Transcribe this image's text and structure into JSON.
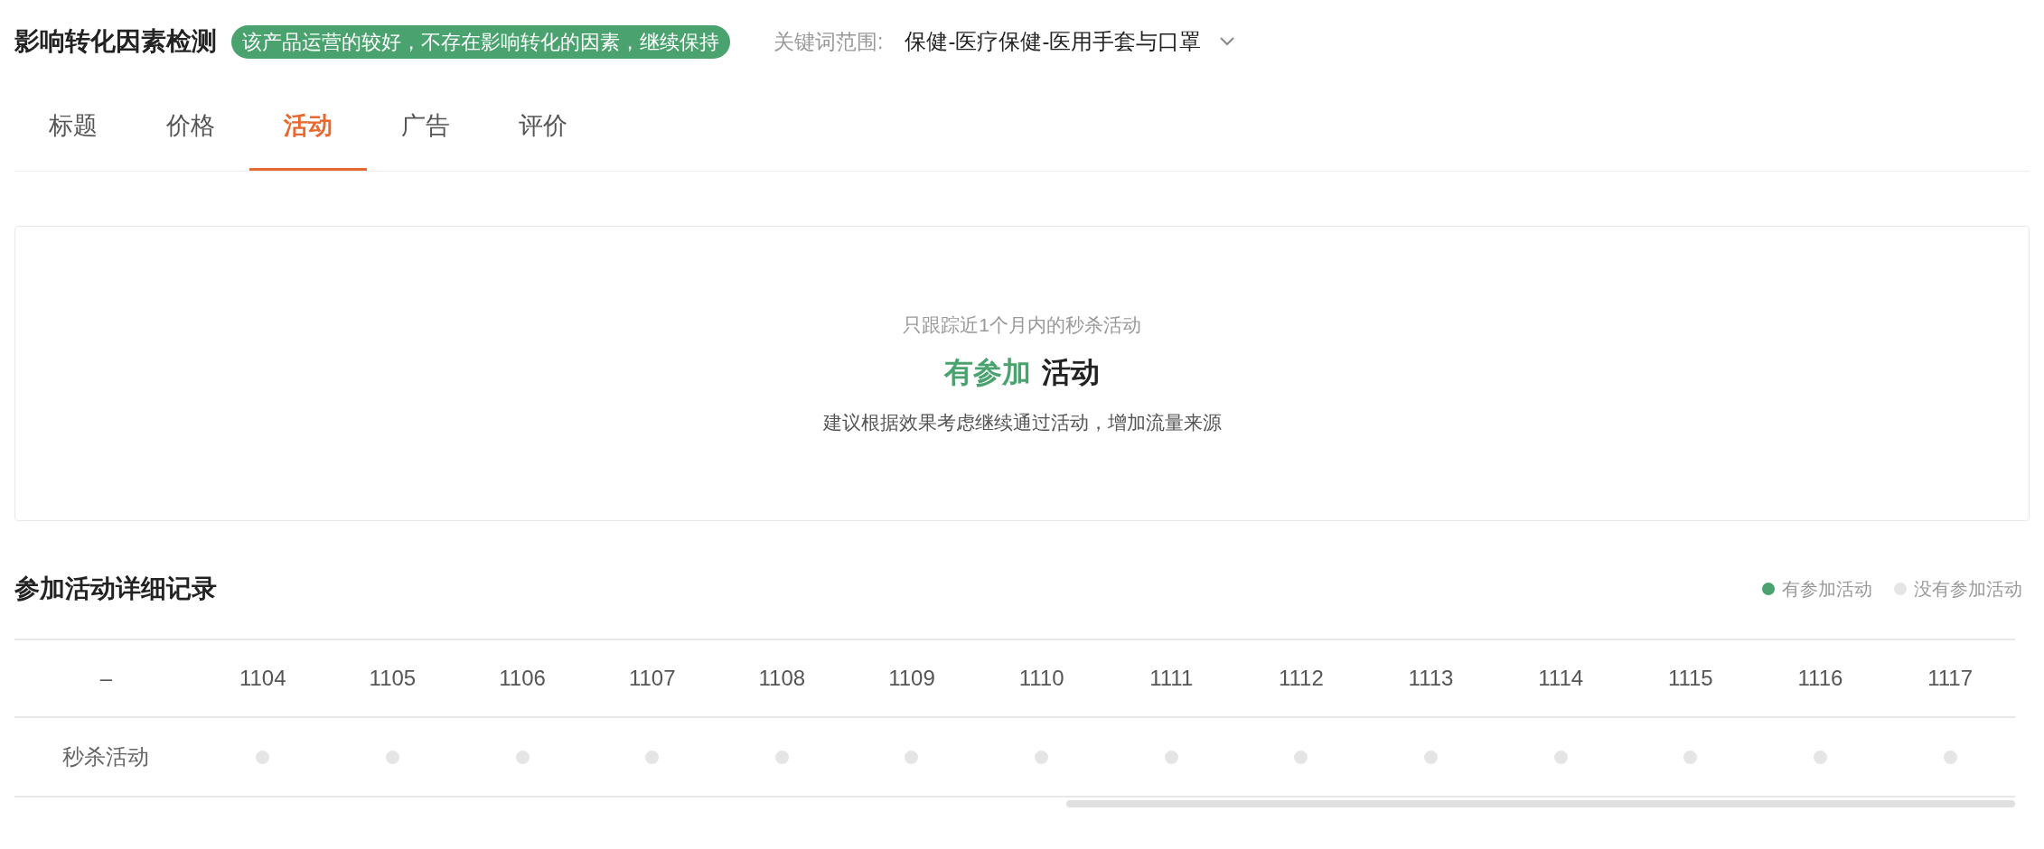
{
  "header": {
    "title": "影响转化因素检测",
    "badge": "该产品运营的较好，不存在影响转化的因素，继续保持",
    "keyword_label": "关键词范围:",
    "keyword_value": "保健-医疗保健-医用手套与口罩"
  },
  "tabs": [
    {
      "label": "标题",
      "selected": false
    },
    {
      "label": "价格",
      "selected": false
    },
    {
      "label": "活动",
      "selected": true
    },
    {
      "label": "广告",
      "selected": false
    },
    {
      "label": "评价",
      "selected": false
    }
  ],
  "summary": {
    "note": "只跟踪近1个月内的秒杀活动",
    "status": "有参加",
    "status_suffix": "活动",
    "advice": "建议根据效果考虑继续通过活动，增加流量来源"
  },
  "records": {
    "title": "参加活动详细记录",
    "legend": [
      {
        "label": "有参加活动",
        "color": "#4aa36f"
      },
      {
        "label": "没有参加活动",
        "color": "#e5e5e5"
      }
    ],
    "corner": "–",
    "columns": [
      "1104",
      "1105",
      "1106",
      "1107",
      "1108",
      "1109",
      "1110",
      "1111",
      "1112",
      "1113",
      "1114",
      "1115",
      "1116",
      "1117"
    ],
    "rows": [
      {
        "label": "秒杀活动",
        "cells": [
          {
            "participated": false
          },
          {
            "participated": false
          },
          {
            "participated": false
          },
          {
            "participated": false
          },
          {
            "participated": false
          },
          {
            "participated": false
          },
          {
            "participated": false
          },
          {
            "participated": false
          },
          {
            "participated": false
          },
          {
            "participated": false
          },
          {
            "participated": false
          },
          {
            "participated": false
          },
          {
            "participated": false
          },
          {
            "participated": false
          }
        ]
      }
    ]
  }
}
